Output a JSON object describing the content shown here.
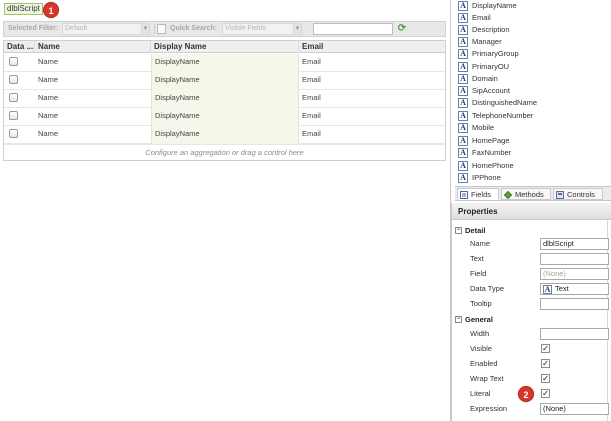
{
  "canvas": {
    "script_label": "dlblScript",
    "badges": {
      "first": "1",
      "second": "2"
    },
    "toolbar": {
      "selected_filter_label": "Selected Filter:",
      "selected_filter_value": "Default",
      "quick_search_label": "Quick Search:",
      "quick_search_value": "Visible Fields",
      "search_text": ""
    },
    "grid": {
      "columns": [
        "Data ...",
        "Name",
        "Display Name",
        "Email"
      ],
      "rows": [
        {
          "name": "Name",
          "display_name": "DisplayName",
          "email": "Email"
        },
        {
          "name": "Name",
          "display_name": "DisplayName",
          "email": "Email"
        },
        {
          "name": "Name",
          "display_name": "DisplayName",
          "email": "Email"
        },
        {
          "name": "Name",
          "display_name": "DisplayName",
          "email": "Email"
        },
        {
          "name": "Name",
          "display_name": "DisplayName",
          "email": "Email"
        }
      ],
      "footer": "Configure an aggregation or drag a control here"
    }
  },
  "fields_panel": {
    "items": [
      "DisplayName",
      "Email",
      "Description",
      "Manager",
      "PrimaryGroup",
      "PrimaryOU",
      "Domain",
      "SipAccount",
      "DistinguishedName",
      "TelephoneNumber",
      "Mobile",
      "HomePage",
      "FaxNumber",
      "HomePhone",
      "IPPhone"
    ],
    "tabs": {
      "fields": "Fields",
      "methods": "Methods",
      "controls": "Controls"
    }
  },
  "properties": {
    "title": "Properties",
    "detail": {
      "section": "Detail",
      "name_label": "Name",
      "name_value": "dlblScript",
      "text_label": "Text",
      "text_value": "",
      "field_label": "Field",
      "field_value": "(None)",
      "datatype_label": "Data Type",
      "datatype_value": "Text",
      "tooltip_label": "Tooltip",
      "tooltip_value": ""
    },
    "general": {
      "section": "General",
      "width_label": "Width",
      "width_value": "",
      "visible_label": "Visible",
      "visible_checked": true,
      "enabled_label": "Enabled",
      "enabled_checked": true,
      "wraptext_label": "Wrap Text",
      "wraptext_checked": true,
      "literal_label": "Literal",
      "literal_checked": true,
      "expression_label": "Expression",
      "expression_value": "(None)"
    },
    "check_glyph": "✓"
  },
  "colors": {
    "badge_red": "#d9362b",
    "label_green": "#9fc26f",
    "display_col_tint": "#f4f7e9",
    "field_icon_blue": "#1e3e78"
  },
  "icons": {
    "field": "text-field-icon",
    "refresh": "refresh-icon",
    "section_toggle": "collapse-minus-icon"
  }
}
